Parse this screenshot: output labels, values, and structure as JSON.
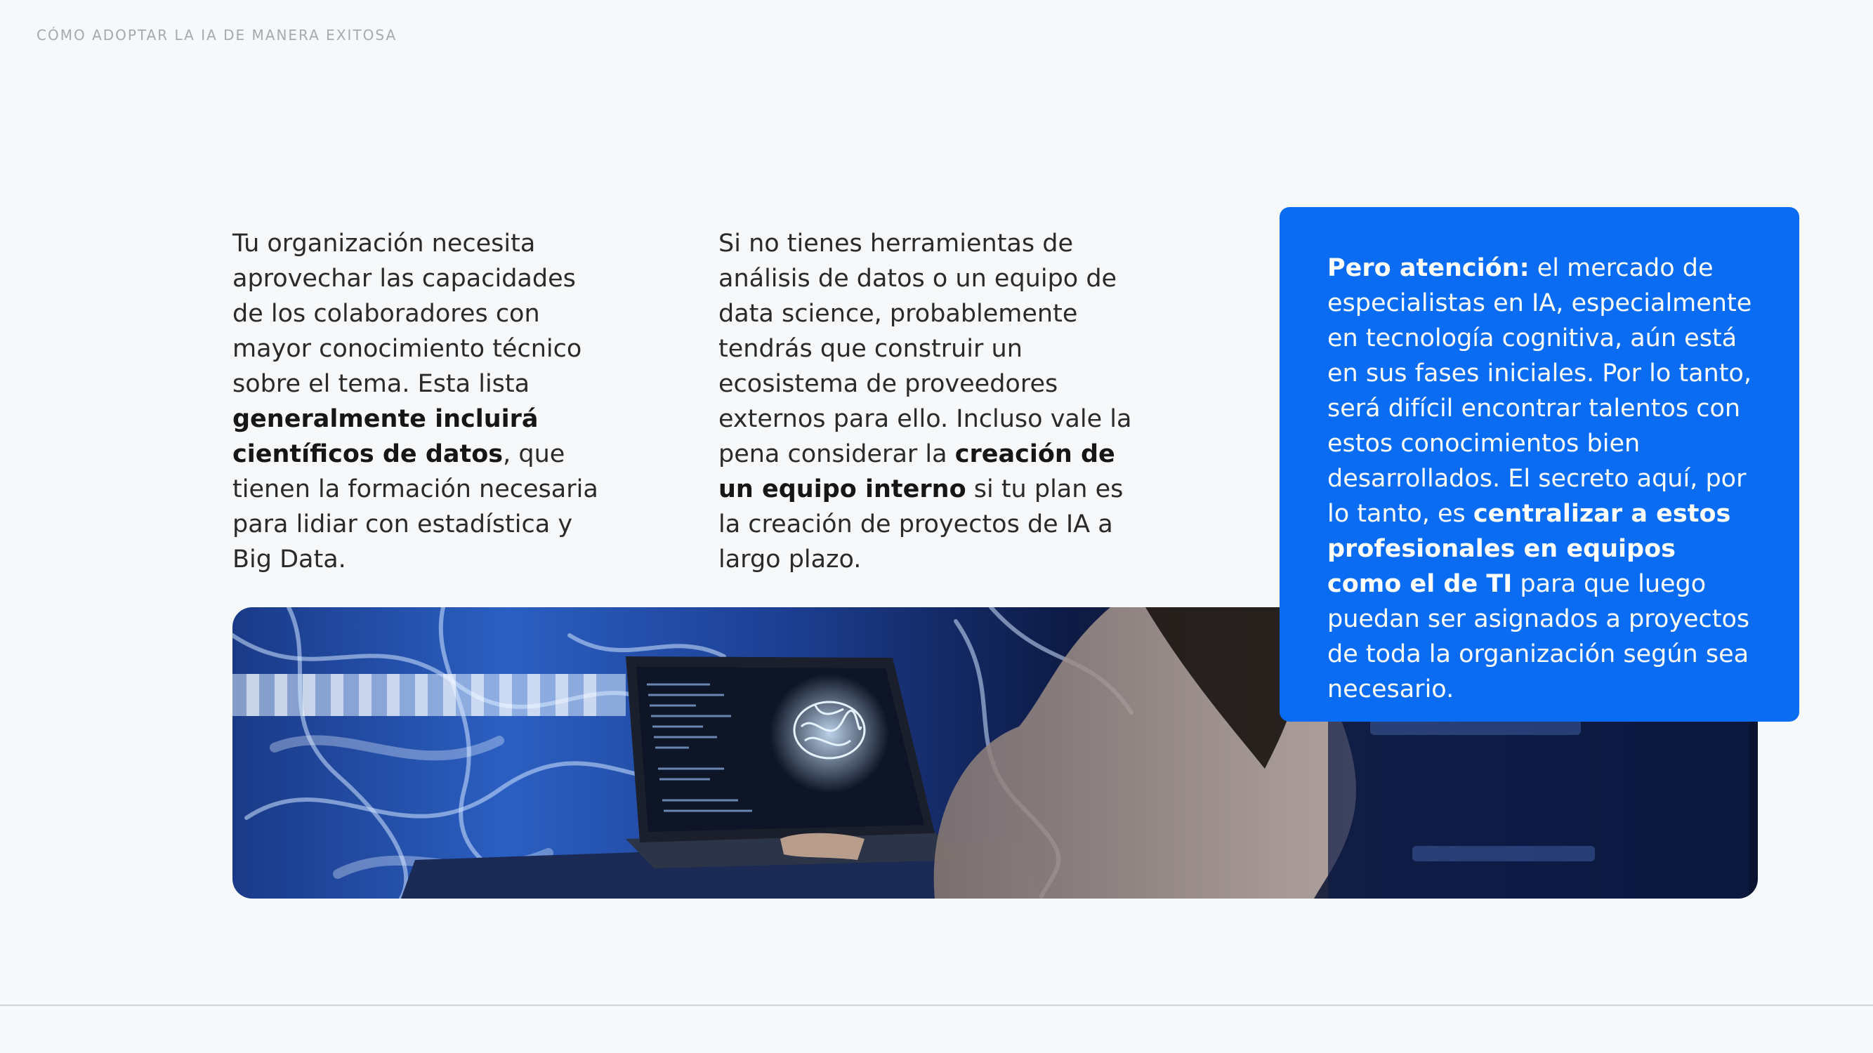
{
  "header": {
    "title": "CÓMO ADOPTAR LA IA DE MANERA EXITOSA"
  },
  "column_1": {
    "intro": "Tu organización necesita aprovechar las capacidades de los colaboradores con mayor conocimiento técnico sobre el tema. Esta lista ",
    "bold": "generalmente incluirá científicos de datos",
    "outro": ", que tienen la formación necesaria para lidiar con estadística y Big Data."
  },
  "column_2": {
    "intro": "Si no tienes herramientas de análisis de datos o un equipo de data science, probablemente tendrás que construir un ecosistema de proveedores externos para ello. Incluso vale la pena considerar la ",
    "bold": "creación de un equipo interno",
    "outro": " si tu plan es la creación de proyectos de IA a largo plazo."
  },
  "callout": {
    "lead_bold": "Pero atención:",
    "intro": " el mercado de especialistas en IA, especialmente en tecnología cognitiva, aún está en sus fases iniciales. Por lo tanto, será difícil encontrar talentos con estos conocimientos bien desarrollados. El secreto aquí, por lo tanto, es ",
    "bold": "centralizar a estos profesionales en equipos como el de TI",
    "outro": " para que luego puedan ser asignados a proyectos de toda la organización según sea necesario."
  },
  "colors": {
    "callout_background": "#0a6cf3",
    "page_background": "#f6f8f9",
    "header_text": "#a3aab0"
  },
  "image": {
    "subject": "woman-using-laptop-with-brain-hologram"
  }
}
